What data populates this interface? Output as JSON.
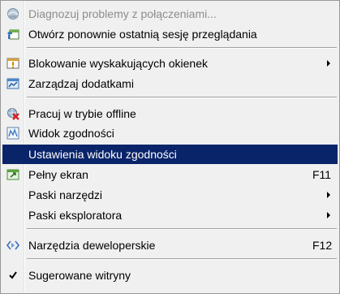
{
  "menu": {
    "items": [
      {
        "label": "Diagnozuj problemy z połączeniami...",
        "icon": "network-diagnose-icon",
        "disabled": true
      },
      {
        "label": "Otwórz ponownie ostatnią sesję przeglądania",
        "icon": "reopen-session-icon"
      },
      {
        "label": "Blokowanie wyskakujących okienek",
        "icon": "popup-blocker-icon",
        "submenu": true
      },
      {
        "label": "Zarządzaj dodatkami",
        "icon": "manage-addons-icon"
      },
      {
        "label": "Pracuj w trybie offline",
        "icon": "work-offline-icon"
      },
      {
        "label": "Widok zgodności",
        "icon": "compatibility-view-icon"
      },
      {
        "label": "Ustawienia widoku zgodności",
        "selected": true
      },
      {
        "label": "Pełny ekran",
        "icon": "fullscreen-icon",
        "shortcut": "F11"
      },
      {
        "label": "Paski narzędzi",
        "submenu": true
      },
      {
        "label": "Paski eksploratora",
        "submenu": true
      },
      {
        "label": "Narzędzia deweloperskie",
        "icon": "developer-tools-icon",
        "shortcut": "F12"
      },
      {
        "label": "Sugerowane witryny",
        "icon": "checkmark-icon",
        "checked": true
      }
    ]
  },
  "colors": {
    "selected_background": "#0a246a",
    "selected_text": "#ffffff",
    "disabled_text": "#8d8d8d",
    "menu_background": "#f0f0f0"
  }
}
